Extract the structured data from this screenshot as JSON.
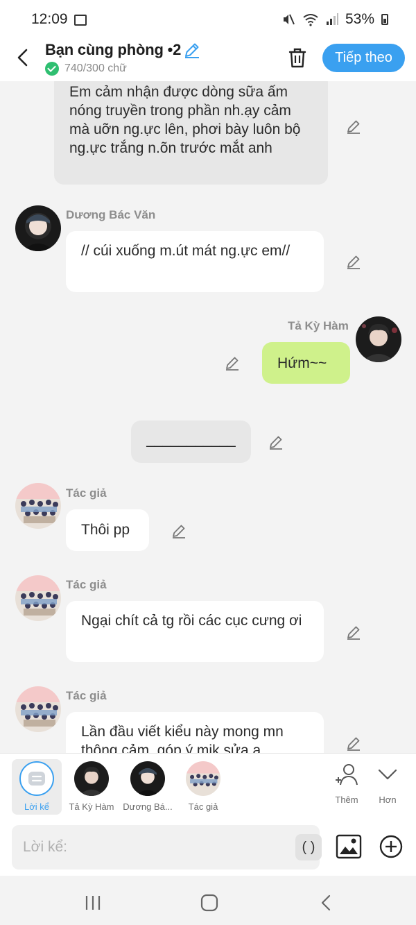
{
  "status_bar": {
    "time": "12:09",
    "battery": "53%"
  },
  "header": {
    "title": "Bạn cùng phòng •2",
    "word_count": "740/300 chữ",
    "next_label": "Tiếp theo"
  },
  "messages": [
    {
      "type": "narration",
      "text": "Em cảm nhận được dòng sữa ấm nóng truyền trong phần nh.ạy cảm mà uỡn ng.ực lên, phơi bày luôn bộ ng.ực trắng n.õn trước mắt anh"
    },
    {
      "type": "left",
      "sender": "Dương Bác Văn",
      "text": "// cúi xuống m.út mát ng.ực em//"
    },
    {
      "type": "right",
      "sender": "Tả Kỳ Hàm",
      "text": "Hứm~~"
    },
    {
      "type": "divider",
      "text": "___________"
    },
    {
      "type": "left",
      "sender": "Tác giả",
      "text": "Thôi pp"
    },
    {
      "type": "left",
      "sender": "Tác giả",
      "text": "Ngại chít cả tg rồi các cục cưng ơi"
    },
    {
      "type": "left",
      "sender": "Tác giả",
      "text": "Lần đầu viết kiểu này mong mn thông cảm, góp ý mik sửa ạ"
    }
  ],
  "character_bar": {
    "items": [
      {
        "label": "Lời kể"
      },
      {
        "label": "Tả Kỳ Hàm"
      },
      {
        "label": "Dương Bá..."
      },
      {
        "label": "Tác giả"
      }
    ],
    "add_label": "Thêm",
    "more_label": "Hơn"
  },
  "input": {
    "placeholder": "Lời kể:",
    "paren_label": "( )"
  },
  "colors": {
    "accent": "#3aa0f0",
    "right_bubble": "#cff18b",
    "success": "#2fbf71"
  }
}
